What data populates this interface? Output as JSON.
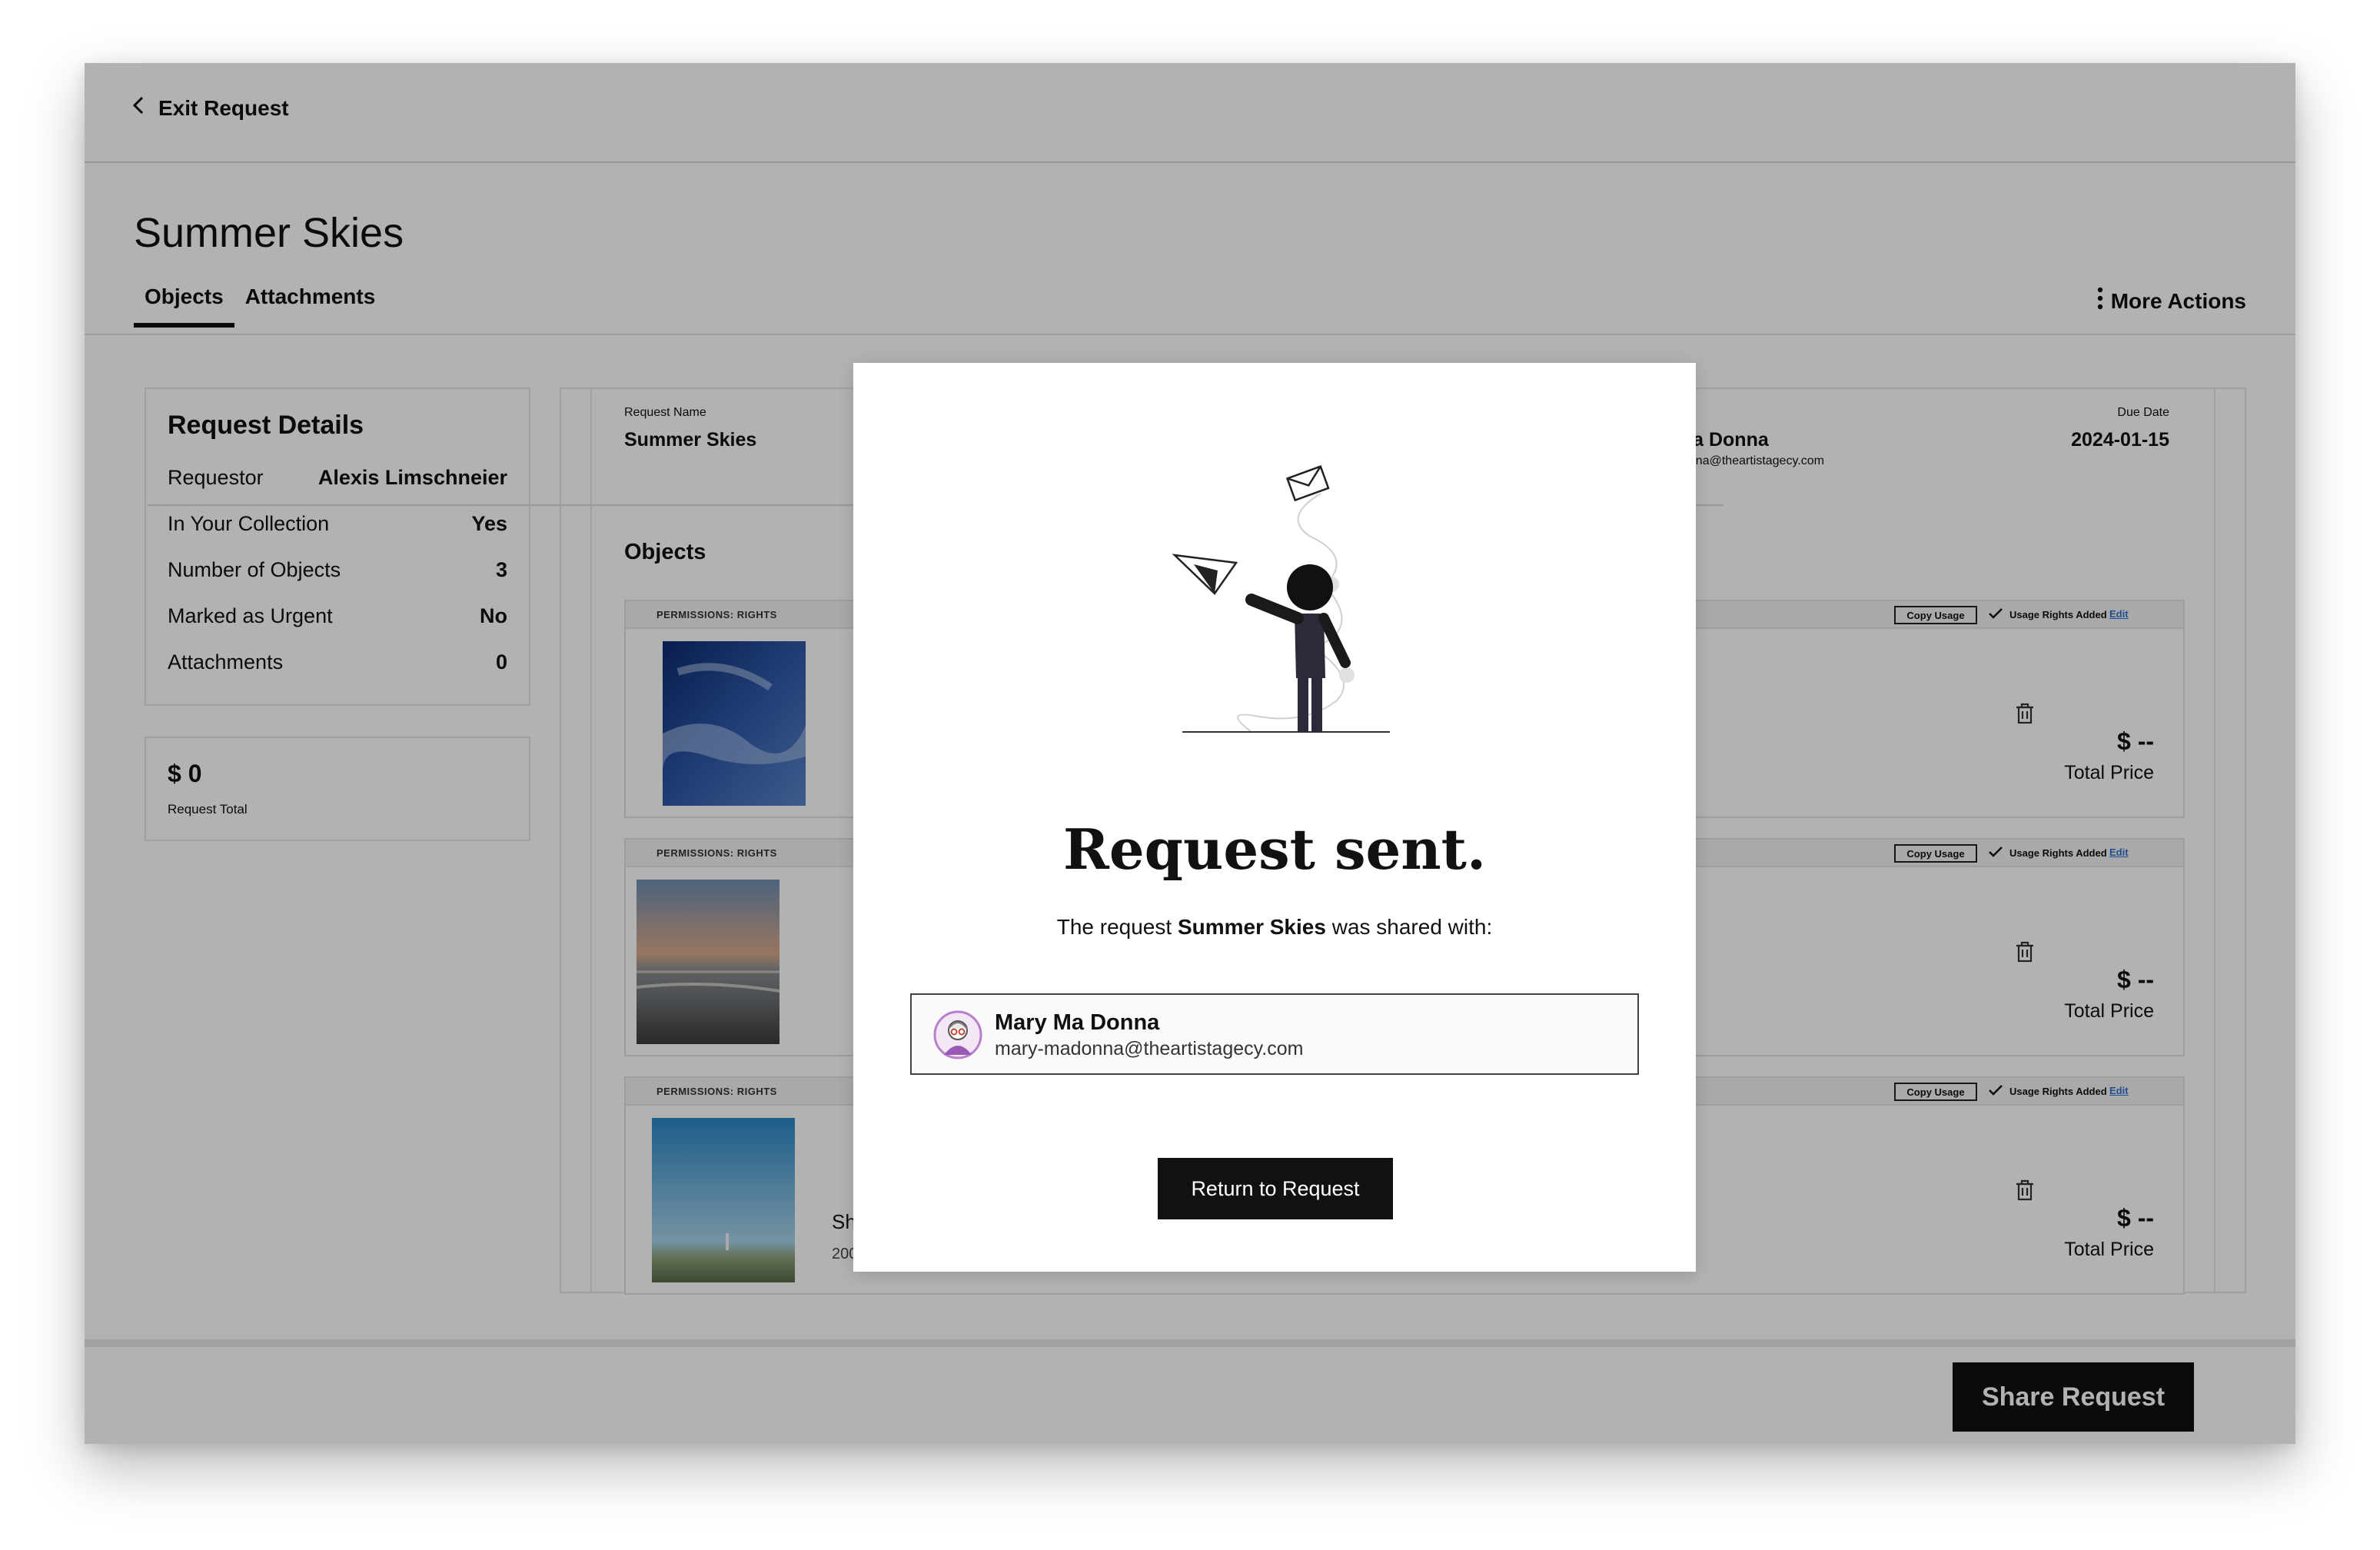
{
  "topbar": {
    "exit_label": "Exit Request"
  },
  "page": {
    "title": "Summer Skies",
    "tabs": [
      {
        "label": "Objects"
      },
      {
        "label": "Attachments"
      }
    ],
    "more_actions": "More Actions"
  },
  "details": {
    "heading": "Request Details",
    "rows": [
      {
        "label": "Requestor",
        "value": "Alexis Limschneier"
      },
      {
        "label": "In Your Collection",
        "value": "Yes"
      },
      {
        "label": "Number of Objects",
        "value": "3"
      },
      {
        "label": "Marked as Urgent",
        "value": "No"
      },
      {
        "label": "Attachments",
        "value": "0"
      }
    ]
  },
  "total": {
    "value": "$ 0",
    "label": "Request Total"
  },
  "request_header": {
    "name_label": "Request Name",
    "name_value": "Summer Skies",
    "recipient_name": "Mary Ma Donna",
    "recipient_email": "mary-madonna@theartistagecy.com",
    "due_label": "Due Date",
    "due_value": "2024-01-15"
  },
  "objects_heading": "Objects",
  "objects": [
    {
      "permissions": "PERMISSIONS: RIGHTS",
      "copy_usage": "Copy Usage",
      "rights": "Usage Rights Added",
      "edit": "Edit",
      "price": "$ --",
      "price_label": "Total Price",
      "name": "",
      "code": ""
    },
    {
      "permissions": "PERMISSIONS: RIGHTS",
      "copy_usage": "Copy Usage",
      "rights": "Usage Rights Added",
      "edit": "Edit",
      "price": "$ --",
      "price_label": "Total Price",
      "name": "",
      "code": ""
    },
    {
      "permissions": "PERMISSIONS: RIGHTS",
      "copy_usage": "Copy Usage",
      "rights": "Usage Rights Added",
      "edit": "Edit",
      "price": "$ --",
      "price_label": "Total Price",
      "name": "Sharon Sky",
      "code": "2001.776"
    }
  ],
  "footer": {
    "share_label": "Share Request"
  },
  "modal": {
    "title": "Request sent.",
    "subtitle_prefix": "The request",
    "subtitle_request": "Summer Skies",
    "subtitle_suffix": "was shared with:",
    "recipient_name": "Mary Ma Donna",
    "recipient_email": "mary-madonna@theartistagecy.com",
    "return_label": "Return to Request"
  },
  "icons": {
    "exit": "chevron-left-icon",
    "more": "vertical-dots-icon",
    "check": "checkmark-icon",
    "trash": "trash-icon",
    "avatar": "user-avatar-icon",
    "illustration": "paper-plane-person-illustration"
  },
  "colors": {
    "overlay": "#000000",
    "primary_button": "#111111",
    "link": "#2b6fd4"
  }
}
